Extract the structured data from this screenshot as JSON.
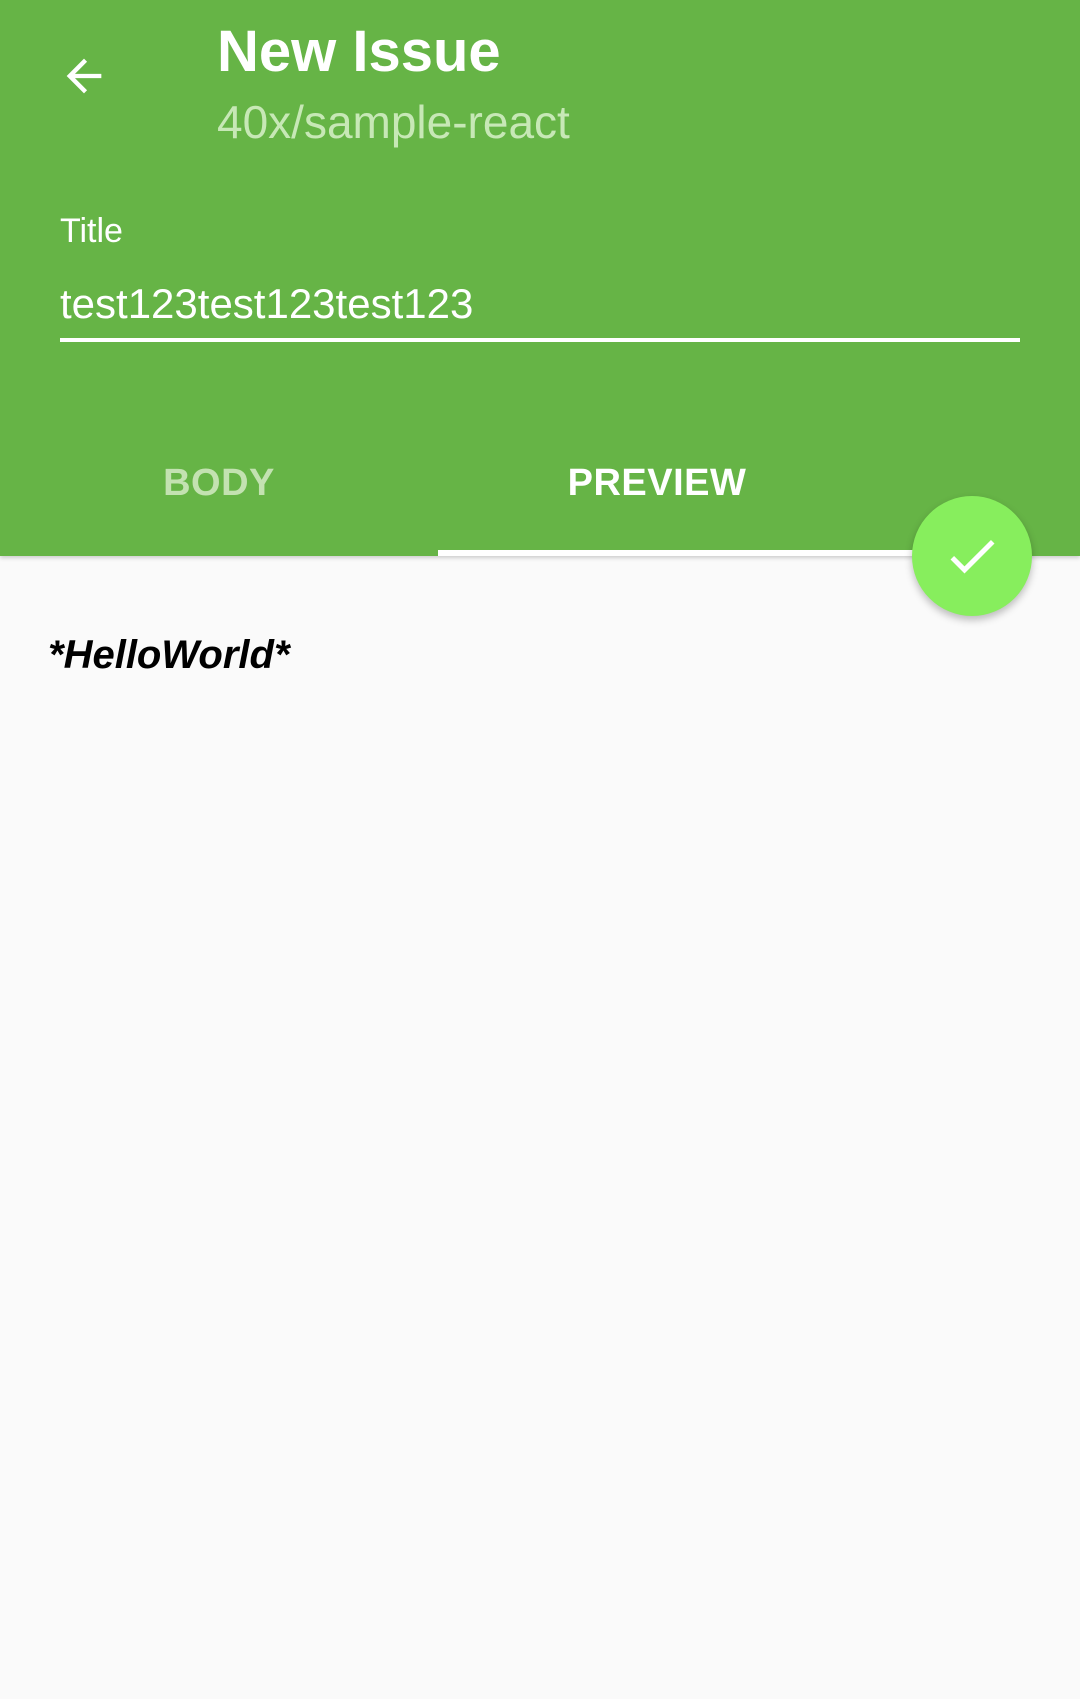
{
  "header": {
    "title": "New Issue",
    "subtitle": "40x/sample-react",
    "back_icon": "arrow-back-icon"
  },
  "title_field": {
    "label": "Title",
    "value": "test123test123test123"
  },
  "tabs": [
    {
      "label": "BODY",
      "selected": false
    },
    {
      "label": "PREVIEW",
      "selected": true
    }
  ],
  "preview": {
    "content": "*HelloWorld*"
  },
  "fab": {
    "icon": "check-icon"
  },
  "colors": {
    "primary": "#66b446",
    "accent": "#87ee5d",
    "background": "#fafafa"
  }
}
